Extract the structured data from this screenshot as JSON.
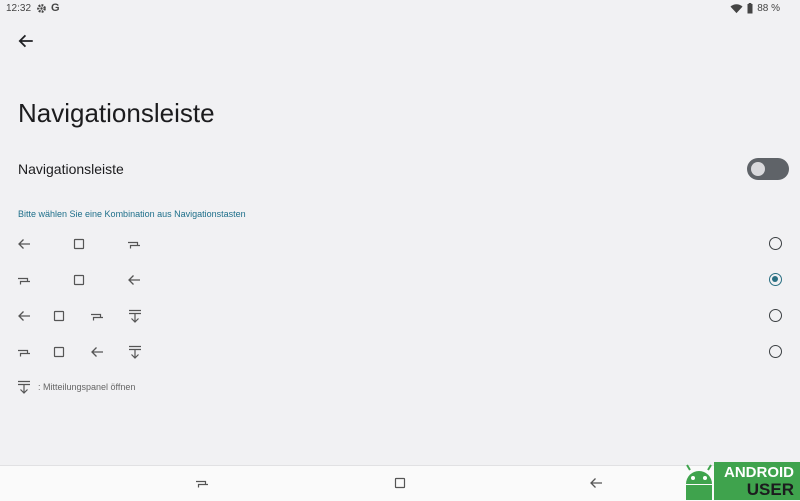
{
  "status": {
    "time": "12:32",
    "battery": "88 %",
    "left_icons": [
      "gear-icon",
      "google-g-icon"
    ],
    "right_icons": [
      "wifi-icon",
      "battery-icon"
    ],
    "g": "G"
  },
  "page": {
    "title": "Navigationsleiste",
    "setting_label": "Navigationsleiste",
    "toggle_on": false,
    "hint": "Bitte wählen Sie eine Kombination aus Navigationstasten"
  },
  "options": [
    {
      "icons": [
        "back-arrow-icon",
        "square-icon",
        "recents-icon"
      ],
      "selected": false
    },
    {
      "icons": [
        "recents-icon",
        "square-icon",
        "back-arrow-icon"
      ],
      "selected": true
    },
    {
      "icons": [
        "back-arrow-icon",
        "square-icon",
        "recents-icon",
        "notification-panel-icon"
      ],
      "selected": false
    },
    {
      "icons": [
        "recents-icon",
        "square-icon",
        "back-arrow-icon",
        "notification-panel-icon"
      ],
      "selected": false
    }
  ],
  "legend": {
    "text": ": Mitteilungspanel öffnen"
  },
  "navbar": [
    "recents-icon",
    "home-square-icon",
    "back-arrow-icon"
  ],
  "watermark": {
    "line1": "ANDROID",
    "line2": "USER"
  },
  "colors": {
    "accent": "#2a6f82",
    "hint": "#1e6f8a",
    "toggle_track": "#5f6368",
    "background": "#f1f1f3"
  }
}
